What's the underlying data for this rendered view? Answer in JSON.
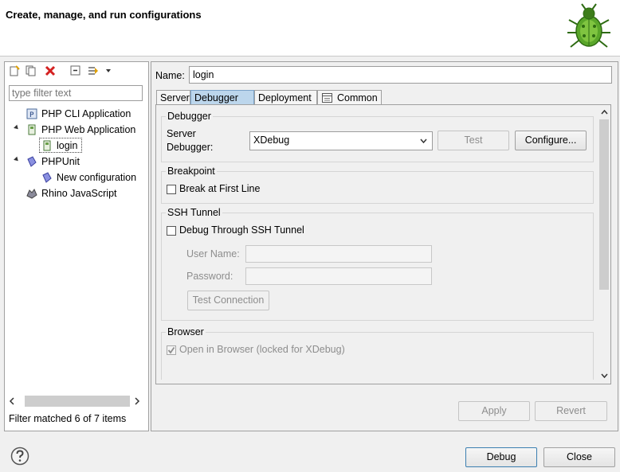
{
  "header": {
    "title": "Create, manage, and run configurations"
  },
  "left": {
    "filter_placeholder": "type filter text",
    "tree": [
      {
        "label": "PHP CLI Application"
      },
      {
        "label": "PHP Web Application"
      },
      {
        "label": "login"
      },
      {
        "label": "PHPUnit"
      },
      {
        "label": "New configuration"
      },
      {
        "label": "Rhino JavaScript"
      }
    ],
    "status": "Filter matched 6 of 7 items"
  },
  "right": {
    "name_label": "Name:",
    "name_value": "login",
    "tabs": [
      {
        "label": "Server"
      },
      {
        "label": "Debugger"
      },
      {
        "label": "Deployment"
      },
      {
        "label": "Common"
      }
    ],
    "debugger_group": {
      "title": "Debugger",
      "server_label_line1": "Server",
      "server_label_line2": "Debugger:",
      "server_value": "XDebug",
      "test_label": "Test",
      "configure_label": "Configure..."
    },
    "breakpoint_group": {
      "title": "Breakpoint",
      "break_first_line": "Break at First Line"
    },
    "ssh_group": {
      "title": "SSH Tunnel",
      "debug_through": "Debug Through SSH Tunnel",
      "user_name_label": "User Name:",
      "password_label": "Password:",
      "test_connection": "Test Connection"
    },
    "browser_group": {
      "title": "Browser",
      "open_in_browser": "Open in Browser (locked for XDebug)"
    },
    "apply_label": "Apply",
    "revert_label": "Revert"
  },
  "footer": {
    "debug_label": "Debug",
    "close_label": "Close"
  },
  "colors": {
    "active_tab": "#bcd6ec",
    "background": "#f0f0f0"
  }
}
